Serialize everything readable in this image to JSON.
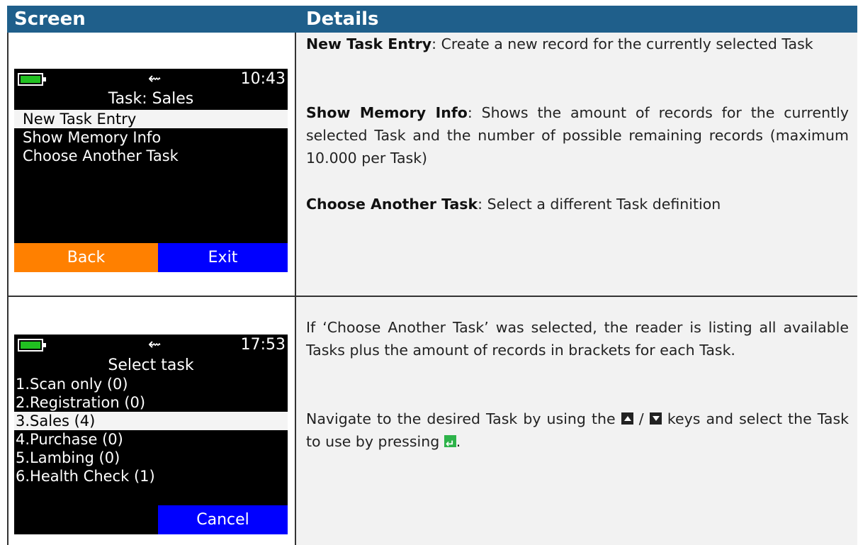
{
  "table": {
    "header": {
      "col1": "Screen",
      "col2": "Details"
    }
  },
  "colors": {
    "header_bg": "#1f5f8b",
    "details_bg": "#f2f2f2",
    "back_key": "#ff8000",
    "exit_key": "#0000ff",
    "battery": "#21c021",
    "enter_key": "#2db34a"
  },
  "row1": {
    "device": {
      "usb_icon": "usb-icon",
      "time": "10:43",
      "title": "Task: Sales",
      "menu": [
        "New Task Entry",
        "Show Memory Info",
        "Choose Another Task"
      ],
      "selected_index": 0,
      "softkeys": {
        "left": "Back",
        "right": "Exit"
      }
    },
    "details": [
      {
        "term": "New Task Entry",
        "text": ": Create a new record for the currently selected Task"
      },
      {
        "term": "Show Memory Info",
        "text": ": Shows the amount of records for the currently selected Task and the number of possible remaining records (maximum 10.000 per Task)"
      },
      {
        "term": "Choose Another Task",
        "text": ": Select a different Task definition"
      }
    ]
  },
  "row2": {
    "device": {
      "usb_icon": "usb-icon",
      "time": "17:53",
      "title": "Select task",
      "list": [
        "1.Scan only (0)",
        "2.Registration (0)",
        "3.Sales (4)",
        "4.Purchase (0)",
        "5.Lambing (0)",
        "6.Health Check (1)"
      ],
      "selected_index": 2,
      "softkeys": {
        "right": "Cancel"
      }
    },
    "details": {
      "para1": "If ‘Choose Another Task’ was selected, the reader is listing all available Tasks plus the amount of records in brackets for each Task.",
      "para2_a": "Navigate to the desired Task by using the ",
      "para2_sep": " / ",
      "para2_b": " keys and select the Task to use by pressing ",
      "para2_end": ".",
      "icons": [
        "up-key-icon",
        "down-key-icon",
        "enter-key-icon"
      ]
    }
  }
}
